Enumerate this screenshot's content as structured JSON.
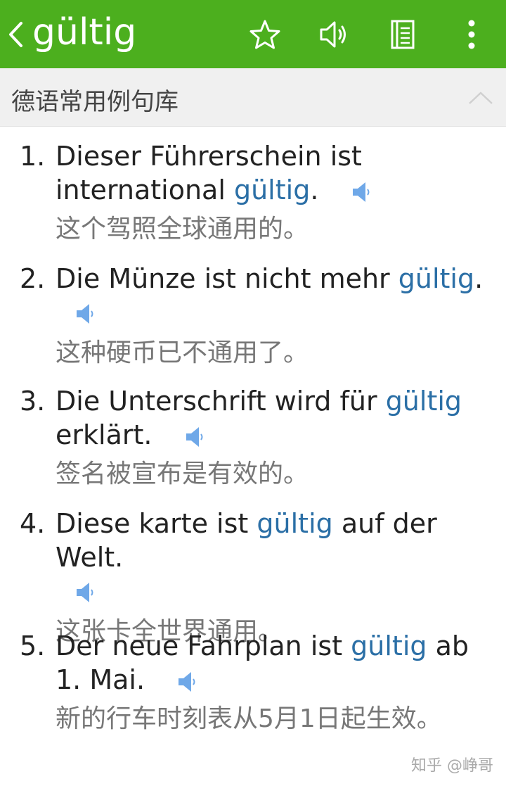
{
  "appbar": {
    "title": "gültig",
    "icons": [
      "back-chevron-icon",
      "star-icon",
      "speaker-icon",
      "notebook-icon",
      "more-vert-icon"
    ],
    "color": "#4caf1e"
  },
  "section": {
    "title": "德语常用例句库",
    "icon": "chevron-up-icon"
  },
  "examples": [
    {
      "num": "1.",
      "pre": "Dieser Führerschein ist international ",
      "kw": "gültig",
      "post": ".",
      "zh": "这个驾照全球通用的。"
    },
    {
      "num": "2.",
      "pre": "Die Münze ist nicht mehr ",
      "kw": "gültig",
      "post": ".",
      "zh": "这种硬币已不通用了。"
    },
    {
      "num": "3.",
      "pre": "Die Unterschrift wird für ",
      "kw": "gültig",
      "post": " erklärt.",
      "zh": "签名被宣布是有效的。"
    },
    {
      "num": "4.",
      "pre": "Diese karte ist ",
      "kw": "gültig",
      "post": " auf der Welt.",
      "zh": "这张卡全世界通用。"
    },
    {
      "num": "5.",
      "pre": "Der neue Fahrplan ist ",
      "kw": "gültig",
      "post": " ab 1. Mai.",
      "zh": "新的行车时刻表从5月1日起生效。"
    }
  ],
  "watermark": "知乎 @峥哥",
  "colors": {
    "keyword": "#2b6fa6",
    "speaker": "#6fa8e8"
  }
}
